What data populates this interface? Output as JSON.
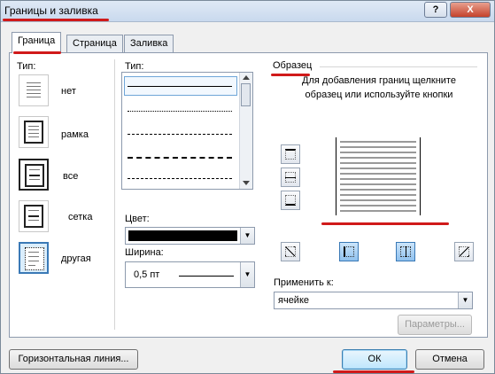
{
  "window": {
    "title": "Границы и заливка",
    "help_glyph": "?",
    "close_glyph": "X"
  },
  "tabs": [
    {
      "label": "Граница",
      "active": true
    },
    {
      "label": "Страница",
      "active": false
    },
    {
      "label": "Заливка",
      "active": false
    }
  ],
  "setting": {
    "label": "Тип:",
    "options": [
      {
        "label": "нет",
        "icon": "preset-none-icon"
      },
      {
        "label": "рамка",
        "icon": "preset-box-icon"
      },
      {
        "label": "все",
        "icon": "preset-all-icon"
      },
      {
        "label": "сетка",
        "icon": "preset-grid-icon"
      },
      {
        "label": "другая",
        "icon": "preset-custom-icon"
      }
    ]
  },
  "style": {
    "label": "Тип:",
    "line_styles": [
      "solid",
      "dotted",
      "dashed-short",
      "dashed",
      "dash-dot"
    ],
    "color_label": "Цвет:",
    "color_value": "#000000",
    "width_label": "Ширина:",
    "width_value": "0,5 пт"
  },
  "preview": {
    "label": "Образец",
    "hint": "Для добавления границ щелкните образец или используйте кнопки",
    "apply_label": "Применить к:",
    "apply_value": "ячейке",
    "options_button": "Параметры..."
  },
  "footer": {
    "hline_button": "Горизонтальная линия...",
    "ok_button": "ОК",
    "cancel_button": "Отмена"
  },
  "colors": {
    "highlight": "#d01a1a",
    "accent": "#3a79b6"
  }
}
